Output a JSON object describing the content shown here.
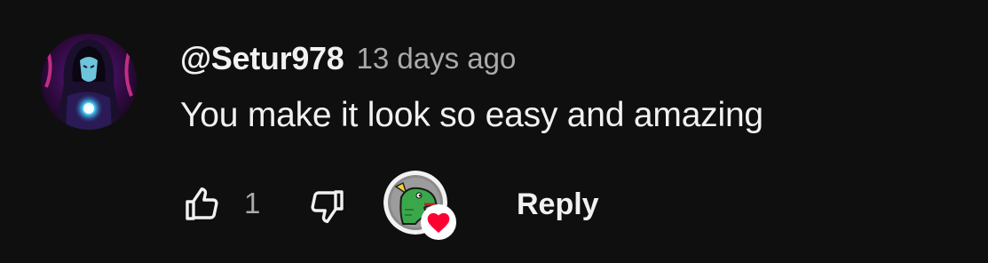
{
  "comment": {
    "author": "@Setur978",
    "timestamp": "13 days ago",
    "text": "You make it look so easy and amazing",
    "avatar_icon": "hooded-figure-avatar",
    "actions": {
      "like_count": "1",
      "like_icon": "thumbs-up-icon",
      "dislike_icon": "thumbs-down-icon",
      "creator_heart_icon": "creator-heart-icon",
      "reply_label": "Reply"
    }
  },
  "colors": {
    "background": "#0f0f0f",
    "primary_text": "#f1f1f1",
    "secondary_text": "#aaaaaa",
    "heart": "#ff0033"
  }
}
